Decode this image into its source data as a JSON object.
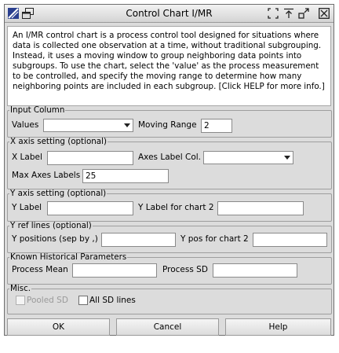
{
  "window": {
    "title": "Control Chart I/MR",
    "title_icon": "app-logo-icon",
    "controls": [
      "restore-icon",
      "pin-icon",
      "minimize-icon",
      "close-icon"
    ]
  },
  "description": "An I/MR control chart is a process control tool designed for situations where data is collected one observation at a time, without traditional subgrouping. Instead, it uses a moving window to group neighboring data points into subgroups. To use the chart, select the 'value' as the process measurement to be controlled, and specify the moving range to determine how many neighboring points are included in each subgroup. [Click HELP for more info.]",
  "input_column": {
    "legend": "Input Column",
    "values_label": "Values",
    "values_selected": "",
    "moving_range_label": "Moving Range",
    "moving_range_value": "2"
  },
  "x_axis": {
    "legend": "X axis setting (optional)",
    "x_label": "X Label",
    "x_label_value": "",
    "axes_label_col": "Axes Label Col.",
    "axes_label_col_selected": "",
    "max_axes_labels": "Max Axes Labels",
    "max_axes_labels_value": "25"
  },
  "y_axis": {
    "legend": "Y axis setting (optional)",
    "y_label": "Y Label",
    "y_label_value": "",
    "y_label_chart2": "Y Label for chart 2",
    "y_label_chart2_value": ""
  },
  "y_ref": {
    "legend": "Y ref lines (optional)",
    "y_positions": "Y positions (sep by ,)",
    "y_positions_value": "",
    "y_pos_chart2": "Y pos for chart 2",
    "y_pos_chart2_value": ""
  },
  "historical": {
    "legend": "Known Historical Parameters",
    "process_mean": "Process Mean",
    "process_mean_value": "",
    "process_sd": "Process SD",
    "process_sd_value": ""
  },
  "misc": {
    "legend": "Misc.",
    "pooled_sd": "Pooled SD",
    "pooled_sd_checked": false,
    "all_sd_lines": "All SD lines",
    "all_sd_lines_checked": false
  },
  "buttons": {
    "ok": "OK",
    "cancel": "Cancel",
    "help": "Help"
  }
}
